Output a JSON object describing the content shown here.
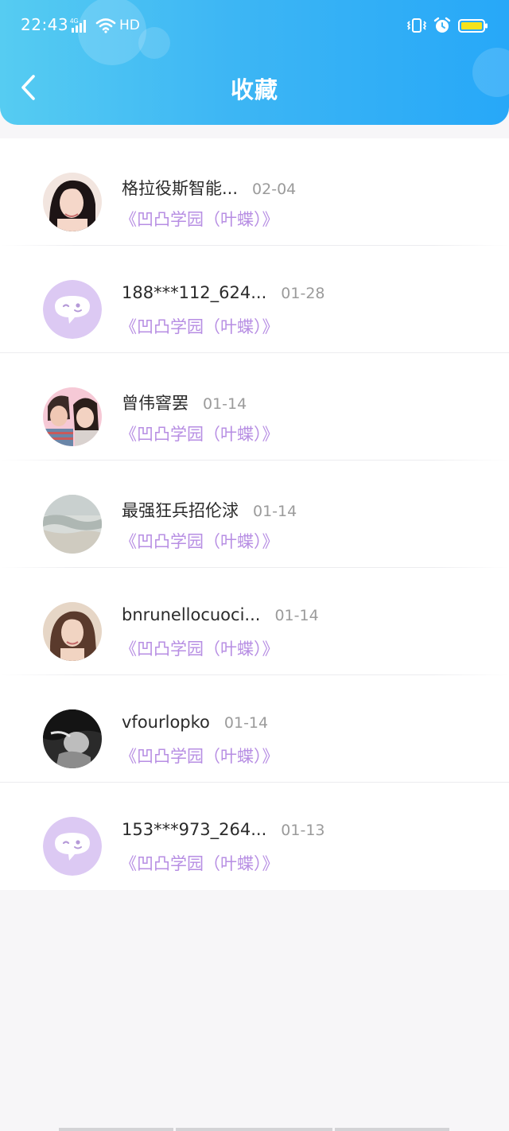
{
  "status_bar": {
    "time": "22:43",
    "network": "4G",
    "hd": "HD"
  },
  "header": {
    "title": "收藏",
    "back_icon": "chevron-left-icon"
  },
  "colors": {
    "header_gradient_start": "#56ccf2",
    "header_gradient_end": "#27a8f8",
    "book_title": "#b78ee3",
    "default_avatar_bg": "#dcc9f3"
  },
  "favorites": [
    {
      "name": "格拉役斯智能...",
      "date": "02-04",
      "book": "《凹凸学园（叶蝶）》",
      "avatar": "photo-avatar-1"
    },
    {
      "name": "188***112_624...",
      "date": "01-28",
      "book": "《凹凸学园（叶蝶）》",
      "avatar": "default-chat-avatar"
    },
    {
      "name": "曾伟窨罢",
      "date": "01-14",
      "book": "《凹凸学园（叶蝶）》",
      "avatar": "photo-avatar-couple"
    },
    {
      "name": "最强狂兵招伦浗",
      "date": "01-14",
      "book": "《凹凸学园（叶蝶）》",
      "avatar": "photo-avatar-beach"
    },
    {
      "name": "bnrunellocuoci...",
      "date": "01-14",
      "book": "《凹凸学园（叶蝶）》",
      "avatar": "photo-avatar-woman"
    },
    {
      "name": "vfourlopko",
      "date": "01-14",
      "book": "《凹凸学园（叶蝶）》",
      "avatar": "photo-avatar-bw"
    },
    {
      "name": "153***973_264...",
      "date": "01-13",
      "book": "《凹凸学园（叶蝶）》",
      "avatar": "default-chat-avatar"
    }
  ]
}
